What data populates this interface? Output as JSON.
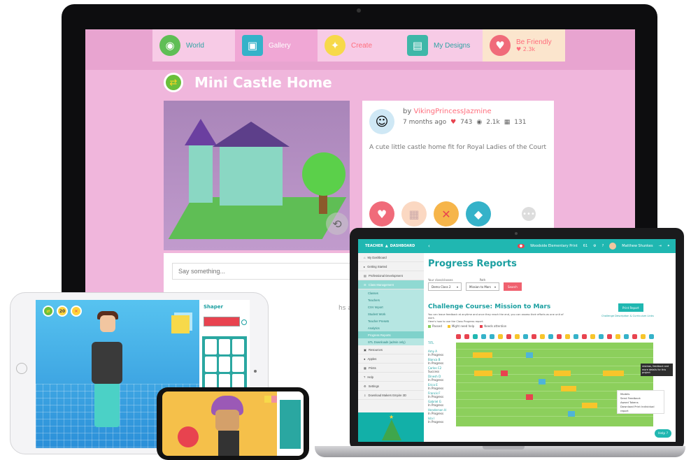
{
  "desktop": {
    "nav": [
      {
        "label": "World",
        "icon": "globe-icon"
      },
      {
        "label": "Gallery",
        "icon": "gallery-icon"
      },
      {
        "label": "Create",
        "icon": "lightbulb-icon"
      },
      {
        "label": "My Designs",
        "icon": "designs-icon"
      },
      {
        "label": "Be Friendly",
        "icon": "friendly-icon",
        "likes": "2.3k"
      }
    ],
    "title": "Mini Castle Home",
    "author_prefix": "by",
    "author": "VikingPrincessJazmine",
    "posted": "7 months ago",
    "likes": "743",
    "views": "2.1k",
    "remixes": "131",
    "description": "A cute little castle home fit for Royal Ladies of the Court",
    "comment_placeholder": "Say something...",
    "comment_ago": "hs ago"
  },
  "laptop": {
    "brand_left": "TEACHER",
    "brand_right": "DASHBOARD",
    "top_right": {
      "school": "Woodside Elementary Print",
      "count": "61",
      "user": "Matthew Shunkes"
    },
    "sidebar": [
      "My Dashboard",
      "Getting Started",
      "Professional Development",
      "Class Management",
      "Classes",
      "Teachers",
      "CSV Import",
      "Student Work",
      "Teacher Presets",
      "Analytics",
      "Progress Reports",
      "STL Downloads (admin only)",
      "Resources",
      "Apples",
      "Prints",
      "Help",
      "Settings",
      "Download Makers Empire 3D"
    ],
    "page_title": "Progress Reports",
    "filter_label_class": "Your class/classes",
    "filter_label_path": "Path",
    "class_value": "Demo Class 2",
    "path_value": "Mission to Mars",
    "search_label": "Search",
    "course_title": "Challenge Course: Mission to Mars",
    "course_desc_1": "You can leave feedback at anytime and once they reach the end, you can assess their efforts as one unit of work.",
    "course_desc_2": "Here's how to use the Class Progress report.",
    "print_label": "Print Report",
    "challenge_link": "Challenge Description & Curriculum Links",
    "legend": [
      {
        "label": "Passed",
        "color": "#8ccf5c"
      },
      {
        "label": "Might need help",
        "color": "#f7c52b"
      },
      {
        "label": "Needs attention",
        "color": "#e8434f"
      }
    ],
    "title_col": "TITL",
    "students": [
      {
        "name": "Amy A",
        "status": "In Progress"
      },
      {
        "name": "Bianca B",
        "status": "In Progress"
      },
      {
        "name": "Carlos C2",
        "status": "Success"
      },
      {
        "name": "Dinesh D",
        "status": "In Progress"
      },
      {
        "name": "Erica E",
        "status": "In Progress"
      },
      {
        "name": "Francis F",
        "status": "In Progress"
      },
      {
        "name": "Gabriel G",
        "status": "In Progress"
      },
      {
        "name": "Henderson H",
        "status": "In Progress"
      },
      {
        "name": "Isla I",
        "status": "In Progress"
      }
    ],
    "tooltip": "reviews, feedback and more details for this project",
    "menu": [
      "Models",
      "Send Feedback",
      "Award Tokens",
      "Download Print Individual report"
    ],
    "help_label": "Help ?"
  },
  "tablet": {
    "badge_num": "20",
    "panel_title": "Shaper"
  },
  "colors": {
    "teal": "#20b7b1",
    "pink_bg": "#f0b6dc",
    "coral": "#ff6d7c",
    "grass": "#8ccf5c"
  }
}
